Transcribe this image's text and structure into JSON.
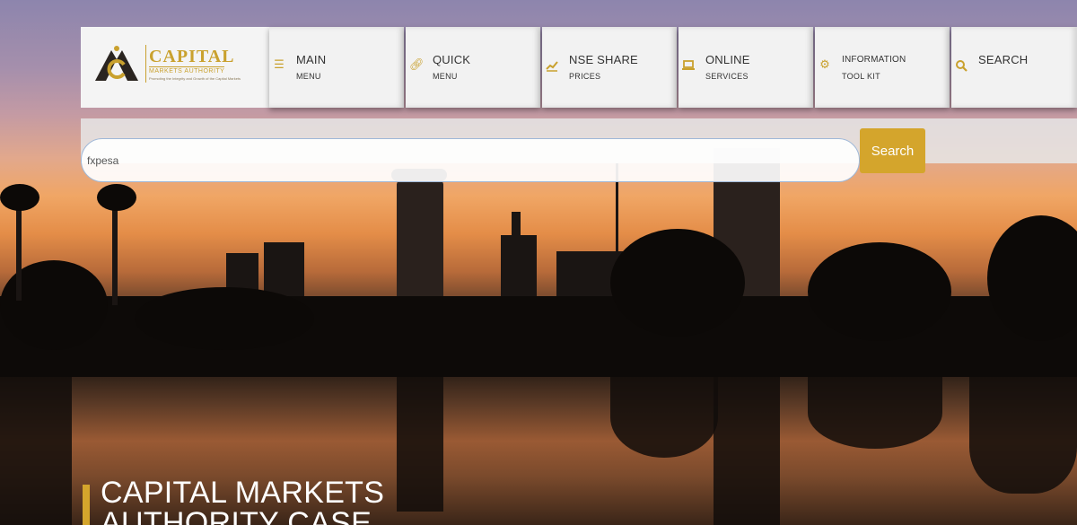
{
  "logo": {
    "title": "CAPITAL",
    "subtitle": "MARKETS AUTHORITY",
    "tagline": "Promoting the Integrity and Growth of the Capital Markets"
  },
  "nav": [
    {
      "main": "MAIN",
      "sub": "MENU",
      "icon": "list-icon"
    },
    {
      "main": "QUICK",
      "sub": "MENU",
      "icon": "link-icon"
    },
    {
      "main": "NSE SHARE",
      "sub": "PRICES",
      "icon": "chart-icon"
    },
    {
      "main": "ONLINE",
      "sub": "SERVICES",
      "icon": "laptop-icon"
    },
    {
      "main": "INFORMATION",
      "sub": "TOOL KIT",
      "icon": "gears-icon"
    },
    {
      "main": "SEARCH",
      "sub": "",
      "icon": "search-icon"
    }
  ],
  "search": {
    "value": "fxpesa",
    "button_label": "Search"
  },
  "hero": {
    "title": "CAPITAL MARKETS AUTHORITY CASE"
  },
  "colors": {
    "accent": "#d4a52c",
    "nav_bg": "#f2f2f2"
  }
}
